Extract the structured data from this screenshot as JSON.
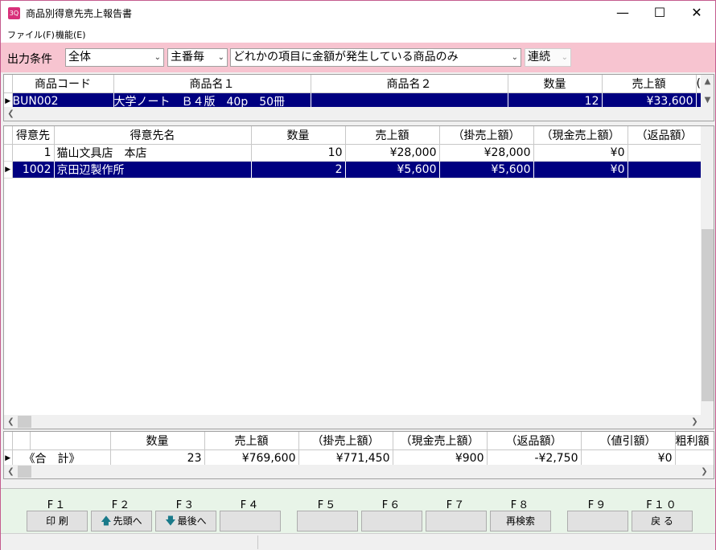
{
  "window": {
    "title": "商品別得意先売上報告書",
    "icon_text": "3Q"
  },
  "menu": [
    "ファイル(F)",
    "機能(E)"
  ],
  "filter": {
    "label": "出力条件",
    "scope": "全体",
    "grouping": "主番毎",
    "condition": "どれかの項目に金額が発生している商品のみ",
    "mode": "連続"
  },
  "products": {
    "columns": [
      "商品コード",
      "商品名１",
      "商品名２",
      "数量",
      "売上額",
      "("
    ],
    "rows": [
      {
        "code": "BUN002",
        "name1": "大学ノート　Ｂ４版　40p　50冊",
        "name2": "",
        "qty": "12",
        "sales": "¥33,600"
      }
    ]
  },
  "customers": {
    "columns": [
      "得意先",
      "得意先名",
      "数量",
      "売上額",
      "（掛売上額）",
      "（現金売上額）",
      "（返品額）"
    ],
    "rows": [
      {
        "id": "1",
        "name": "猫山文具店　本店",
        "qty": "10",
        "sales": "¥28,000",
        "credit": "¥28,000",
        "cash": "¥0",
        "returns": ""
      },
      {
        "id": "1002",
        "name": "京田辺製作所",
        "qty": "2",
        "sales": "¥5,600",
        "credit": "¥5,600",
        "cash": "¥0",
        "returns": ""
      }
    ]
  },
  "totals": {
    "columns": [
      "",
      "数量",
      "売上額",
      "（掛売上額）",
      "（現金売上額）",
      "（返品額）",
      "（値引額）",
      "粗利額"
    ],
    "row": {
      "label": "《合　計》",
      "qty": "23",
      "sales": "¥769,600",
      "credit": "¥771,450",
      "cash": "¥900",
      "returns": "-¥2,750",
      "discount": "¥0",
      "profit": ""
    }
  },
  "fkeys": [
    {
      "key": "F１",
      "label": "印 刷",
      "icon": ""
    },
    {
      "key": "F２",
      "label": "先頭へ",
      "icon": "arrow-up-icon"
    },
    {
      "key": "F３",
      "label": "最後へ",
      "icon": "arrow-down-icon"
    },
    {
      "key": "F４",
      "label": "",
      "icon": ""
    },
    {
      "key": "F５",
      "label": "",
      "icon": ""
    },
    {
      "key": "F６",
      "label": "",
      "icon": ""
    },
    {
      "key": "F７",
      "label": "",
      "icon": ""
    },
    {
      "key": "F８",
      "label": "再検索",
      "icon": ""
    },
    {
      "key": "F９",
      "label": "",
      "icon": ""
    },
    {
      "key": "F１０",
      "label": "戻 る",
      "icon": ""
    }
  ],
  "colors": {
    "selection": "#000080",
    "filter_bar": "#f7c4d0",
    "accent": "#d8307a"
  }
}
